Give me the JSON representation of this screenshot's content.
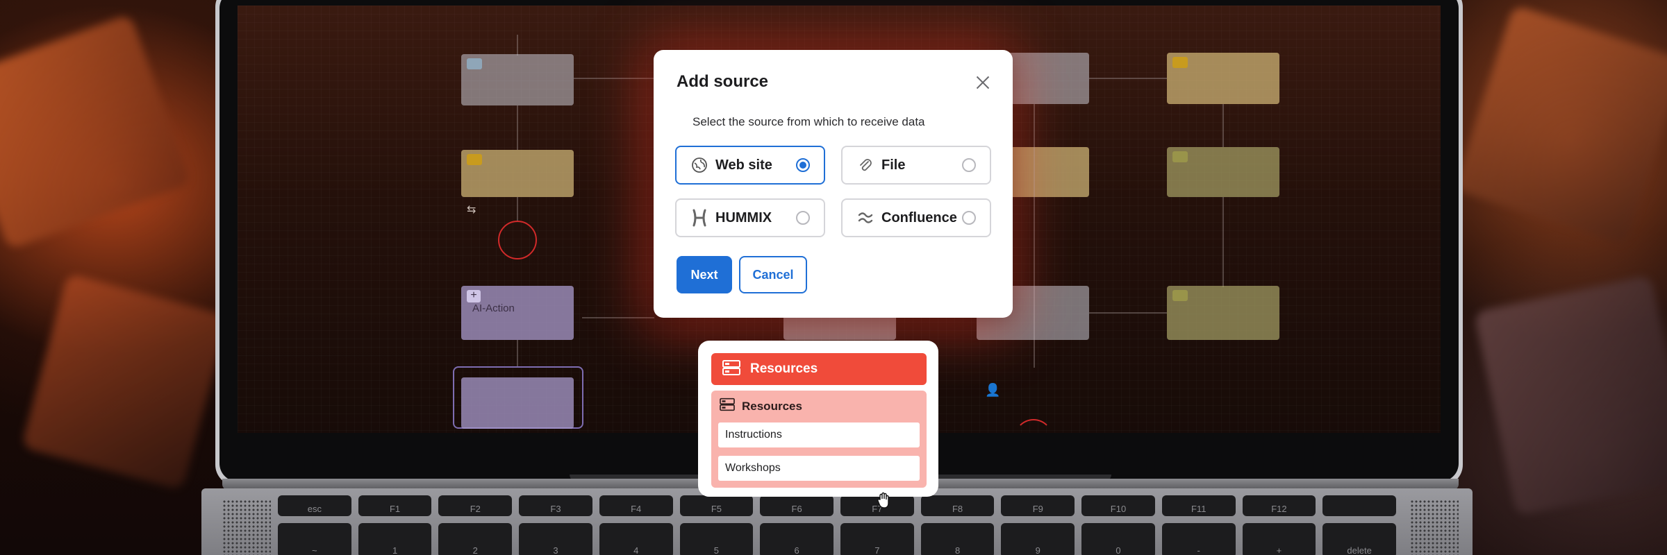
{
  "modal": {
    "title": "Add source",
    "subtitle": "Select the source from which to receive data",
    "options": [
      {
        "label": "Web site",
        "selected": true,
        "icon": "globe-icon"
      },
      {
        "label": "File",
        "selected": false,
        "icon": "paperclip-icon"
      },
      {
        "label": "HUMMIX",
        "selected": false,
        "icon": "hummix-logo-icon"
      },
      {
        "label": "Confluence",
        "selected": false,
        "icon": "confluence-logo-icon"
      }
    ],
    "next_label": "Next",
    "cancel_label": "Cancel"
  },
  "canvas": {
    "ai_action_label": "AI-Action"
  },
  "resources": {
    "header_label": "Resources",
    "group_label": "Resources",
    "items": [
      "Instructions",
      "Workshops"
    ]
  },
  "keyboard": {
    "top_row": [
      "esc",
      "F1",
      "F2",
      "F3",
      "F4",
      "F5",
      "F6",
      "F7",
      "F8",
      "F9",
      "F10",
      "F11",
      "F12",
      ""
    ],
    "number_row": [
      "~",
      "1",
      "2",
      "3",
      "4",
      "5",
      "6",
      "7",
      "8",
      "9",
      "0",
      "-",
      "+",
      "delete"
    ]
  },
  "colors": {
    "accent": "#1f6fd6",
    "resource_header": "#f04b3a",
    "resource_body": "#f9b3ad"
  }
}
